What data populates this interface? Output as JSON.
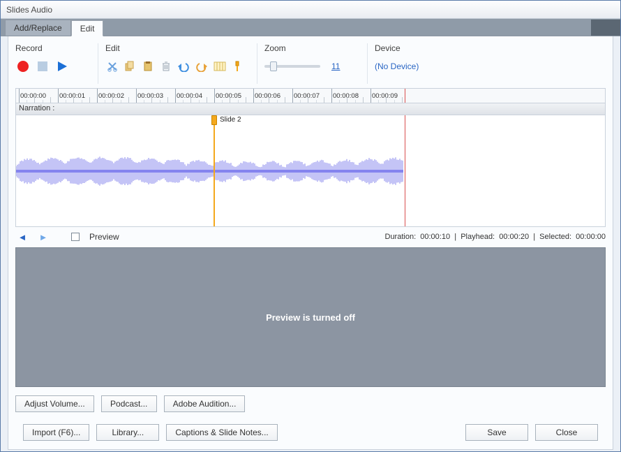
{
  "title": "Slides Audio",
  "tabs": {
    "add_replace": "Add/Replace",
    "edit": "Edit"
  },
  "groups": {
    "record": "Record",
    "edit": "Edit",
    "zoom": "Zoom",
    "device": "Device"
  },
  "zoom": {
    "value": "11"
  },
  "device": {
    "selected": "(No Device)"
  },
  "timeline": {
    "ticks": [
      "00:00:00",
      "00:00:01",
      "00:00:02",
      "00:00:03",
      "00:00:04",
      "00:00:05",
      "00:00:06",
      "00:00:07",
      "00:00:08",
      "00:00:09"
    ],
    "narration_label": "Narration :",
    "marker_label": "Slide 2"
  },
  "status": {
    "preview_checkbox_label": "Preview",
    "duration_label": "Duration:",
    "duration_value": "00:00:10",
    "playhead_label": "Playhead:",
    "playhead_value": "00:00:20",
    "selected_label": "Selected:",
    "selected_value": "00:00:00"
  },
  "preview": {
    "off_message": "Preview is turned off"
  },
  "buttons": {
    "adjust_volume": "Adjust Volume...",
    "podcast": "Podcast...",
    "adobe_audition": "Adobe Audition...",
    "import": "Import (F6)...",
    "library": "Library...",
    "captions": "Captions & Slide Notes...",
    "save": "Save",
    "close": "Close"
  }
}
